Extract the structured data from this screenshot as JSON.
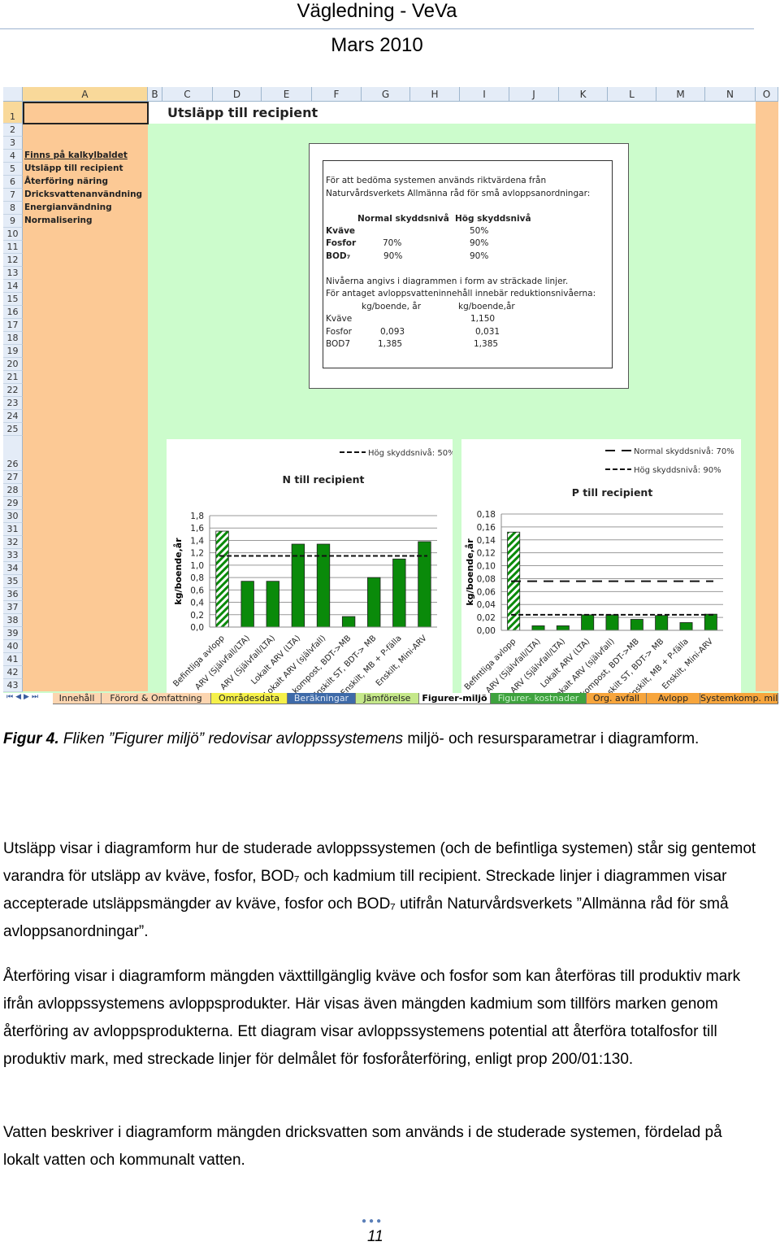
{
  "header": {
    "title": "Vägledning - VeVa",
    "date": "Mars 2010"
  },
  "sheet": {
    "columns": [
      "A",
      "B",
      "C",
      "D",
      "E",
      "F",
      "G",
      "H",
      "I",
      "J",
      "K",
      "L",
      "M",
      "N",
      "O"
    ],
    "rows": [
      "1",
      "2",
      "3",
      "4",
      "5",
      "6",
      "7",
      "8",
      "9",
      "10",
      "11",
      "12",
      "13",
      "14",
      "15",
      "16",
      "17",
      "18",
      "19",
      "20",
      "21",
      "22",
      "23",
      "24",
      "25",
      "26",
      "27",
      "28",
      "29",
      "30",
      "31",
      "32",
      "33",
      "34",
      "35",
      "36",
      "37",
      "38",
      "39",
      "40",
      "41",
      "42",
      "43"
    ],
    "title": "Utsläpp till recipient",
    "nav_heading": "Finns på kalkylbaldet",
    "nav_links": [
      "Utsläpp till recipient",
      "Återföring näring",
      "Dricksvattenanvändning",
      "Energianvändning",
      "Normalisering"
    ],
    "info": {
      "intro1": "För att bedöma systemen används riktvärdena från",
      "intro2": "Naturvårdsverkets Allmänna råd för små avloppsanordningar:",
      "col1": "Normal skyddsnivå",
      "col2": "Hög skyddsnivå",
      "rows": [
        {
          "label": "Kväve",
          "normal": "",
          "hog": "50%"
        },
        {
          "label": "Fosfor",
          "normal": "70%",
          "hog": "90%"
        },
        {
          "label": "BOD₇",
          "normal": "90%",
          "hog": "90%"
        }
      ],
      "note1": "Nivåerna angivs i diagrammen  i form av sträckade linjer.",
      "note2": "För antaget avloppsvatteninnehåll  innebär reduktionsnivåerna:",
      "unit1": "kg/boende, år",
      "unit2": "kg/boende,år",
      "values": [
        {
          "label": "Kväve",
          "normal": "",
          "hog": "1,150"
        },
        {
          "label": "Fosfor",
          "normal": "0,093",
          "hog": "0,031"
        },
        {
          "label": "BOD7",
          "normal": "1,385",
          "hog": "1,385"
        }
      ]
    },
    "tabs": [
      {
        "label": "Innehåll",
        "color": "#fcd5b0",
        "text": "#222"
      },
      {
        "label": "Förord & Omfattning",
        "color": "#fcd5b0",
        "text": "#222"
      },
      {
        "label": "Områdesdata",
        "color": "#f5f04a",
        "text": "#222"
      },
      {
        "label": "Beräkningar",
        "color": "#3e6aa8",
        "text": "#dfe8f5"
      },
      {
        "label": "Jämförelse",
        "color": "#c5e88a",
        "text": "#222"
      },
      {
        "label": "Figurer-miljö",
        "color": "#ffffff",
        "text": "#000"
      },
      {
        "label": "Figurer- kostnader",
        "color": "#3ea23e",
        "text": "#c8f0c8"
      },
      {
        "label": "Org. avfall",
        "color": "#f7a53c",
        "text": "#222"
      },
      {
        "label": "Avlopp",
        "color": "#f7a53c",
        "text": "#222"
      },
      {
        "label": "Systemkomp. milj",
        "color": "#f7a53c",
        "text": "#222"
      }
    ]
  },
  "chart_data": [
    {
      "type": "bar",
      "title": "N till recipient",
      "ylabel": "kg/boende,år",
      "xlabel": "",
      "categories": [
        "Befintliga avlopp",
        "ARV (Självfall/LTA)",
        "ARV (Självfall/LTA)",
        "Lokalt ARV (LTA)",
        "Lokalt ARV (självfall)",
        "kompost, BDT->MB",
        "Enskilt ST, BDT-> MB",
        "Enskilt, MB + P-fälla",
        "Enskilt, Mini-ARV"
      ],
      "values": [
        1.55,
        0.74,
        0.74,
        1.34,
        1.34,
        0.17,
        0.8,
        1.1,
        1.38
      ],
      "ylim": [
        0,
        1.8
      ],
      "yticks": [
        "0,0",
        "0,2",
        "0,4",
        "0,6",
        "0,8",
        "1,0",
        "1,2",
        "1,4",
        "1,6",
        "1,8"
      ],
      "grid": true,
      "bar_color": "#0a8a0a",
      "first_bar": "hatched",
      "lines": [
        {
          "name": "Hög skyddsnivå: 50%",
          "value": 1.15,
          "style": "short-dash"
        }
      ],
      "legend": "top-right"
    },
    {
      "type": "bar",
      "title": "P till recipient",
      "ylabel": "kg/boende,år",
      "xlabel": "",
      "categories": [
        "Befintliga avlopp",
        "ARV (Självfall/LTA)",
        "ARV (Självfall/LTA)",
        "Lokalt ARV (LTA)",
        "Lokalt ARV (självfall)",
        "kompost, BDT->MB",
        "Enskilt ST, BDT-> MB",
        "Enskilt, MB + P-fälla",
        "Enskilt, Mini-ARV"
      ],
      "values": [
        0.152,
        0.007,
        0.007,
        0.024,
        0.024,
        0.017,
        0.023,
        0.012,
        0.025
      ],
      "ylim": [
        0,
        0.18
      ],
      "yticks": [
        "0,00",
        "0,02",
        "0,04",
        "0,06",
        "0,08",
        "0,10",
        "0,12",
        "0,14",
        "0,16",
        "0,18"
      ],
      "grid": true,
      "bar_color": "#0a8a0a",
      "first_bar": "hatched",
      "lines": [
        {
          "name": "Normal skyddsnivå:  70%",
          "value": 0.076,
          "style": "long-dash"
        },
        {
          "name": "Hög skyddsnivå:  90%",
          "value": 0.024,
          "style": "short-dash"
        }
      ],
      "legend": "top-right"
    }
  ],
  "caption": {
    "label": "Figur 4.",
    "italic": " Fliken ”Figurer miljö” redovisar avloppssystemens",
    "rest": " miljö- och resursparametrar i diagramform."
  },
  "body": [
    "Utsläpp visar i diagramform hur de studerade avloppssystemen (och de befintliga systemen) står sig gentemot varandra för utsläpp av kväve, fosfor, BOD₇ och kadmium till recipient. Streckade linjer i diagrammen visar accepterade utsläppsmängder av kväve, fosfor och BOD₇ utifrån Naturvårdsverkets ”Allmänna råd för små avloppsanordningar”.",
    "Återföring visar i diagramform mängden växttillgänglig kväve och fosfor som kan återföras till produktiv mark ifrån avloppssystemens avloppsprodukter. Här visas även mängden kadmium som tillförs marken genom återföring av avloppsprodukterna. Ett diagram visar avloppssystemens potential att återföra totalfosfor till produktiv mark, med streckade linjer för delmålet för fosforåterföring, enligt prop 200/01:130.",
    "Vatten beskriver i diagramform mängden dricksvatten som används i de studerade systemen, fördelad på lokalt vatten och kommunalt vatten."
  ],
  "footer": {
    "page": "11"
  }
}
